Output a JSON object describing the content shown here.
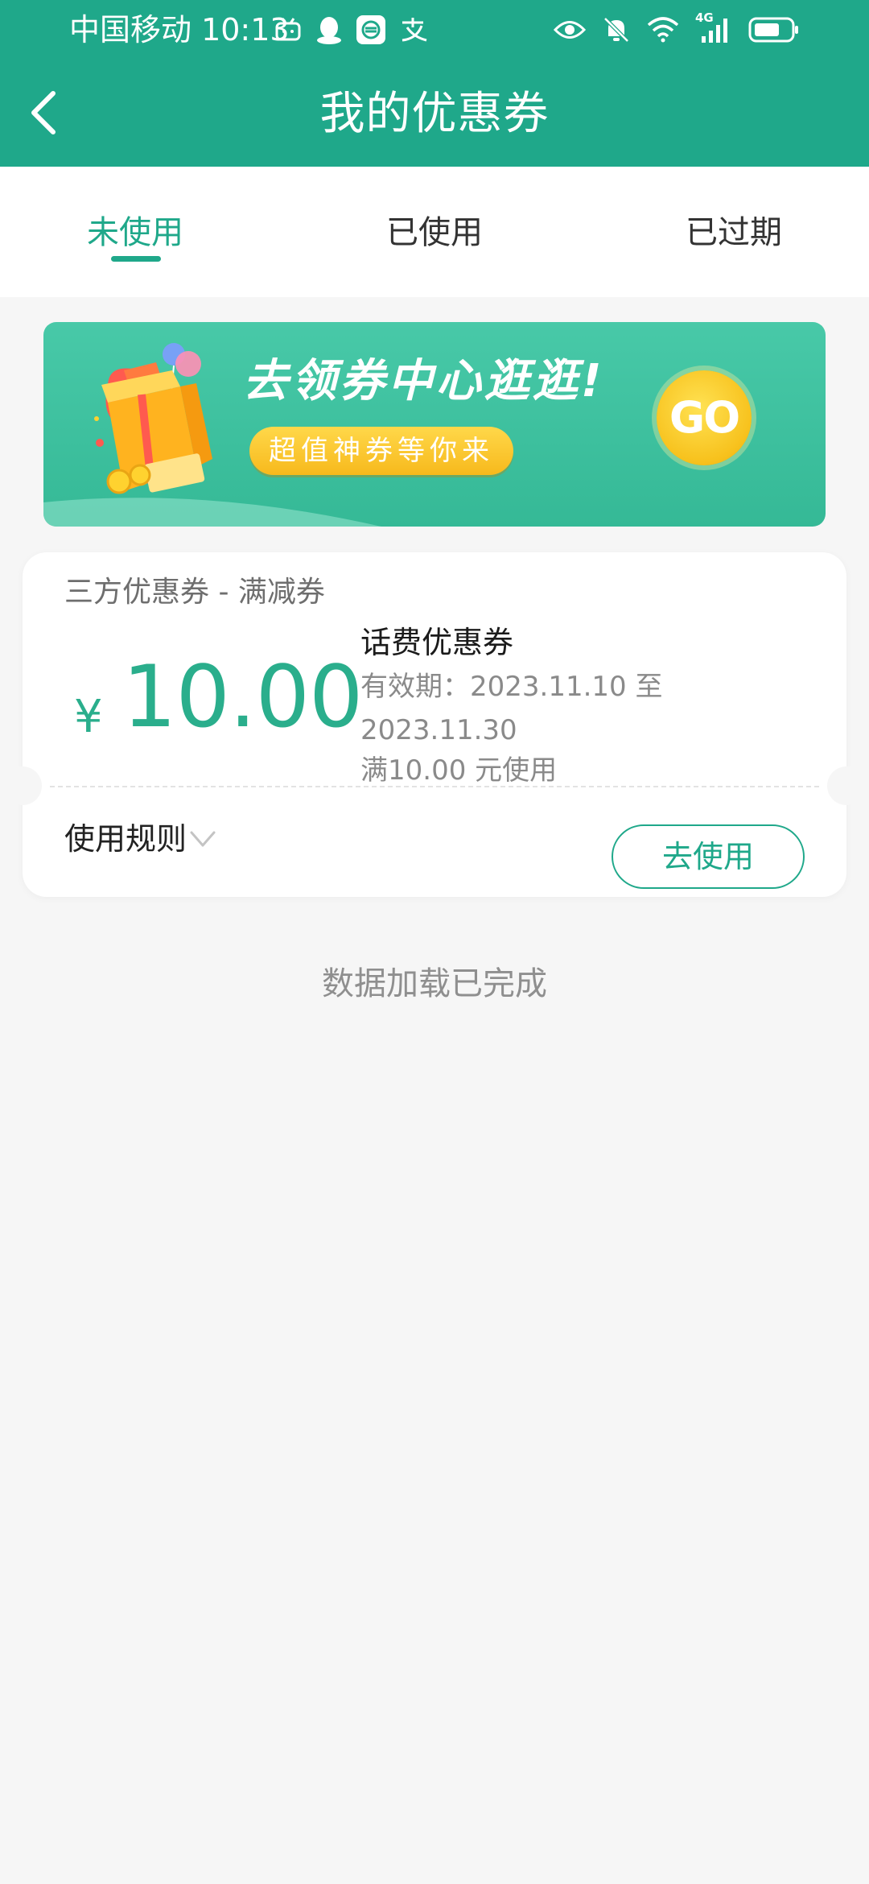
{
  "status_bar": {
    "carrier_time": "中国移动 10:13",
    "network_label": "4G",
    "icons_left": [
      "bilibili-icon",
      "qq-icon",
      "app-icon",
      "alipay-icon"
    ],
    "icons_right": [
      "eye-icon",
      "mute-bell-icon",
      "wifi-icon",
      "signal-icon",
      "battery-icon"
    ]
  },
  "header": {
    "title": "我的优惠券",
    "back_icon": "chevron-left-icon"
  },
  "tabs": [
    {
      "label": "未使用",
      "active": true
    },
    {
      "label": "已使用",
      "active": false
    },
    {
      "label": "已过期",
      "active": false
    }
  ],
  "banner": {
    "title": "去领券中心逛逛!",
    "subtitle": "超值神券等你来",
    "go_label": "GO"
  },
  "coupon": {
    "type_label": "三方优惠券 - 满减券",
    "currency": "¥",
    "amount": "10.00",
    "name": "话费优惠券",
    "validity": "有效期：2023.11.10 至 2023.11.30",
    "condition": "满10.00 元使用",
    "rules_label": "使用规则",
    "use_button": "去使用"
  },
  "footer": {
    "load_status": "数据加载已完成"
  },
  "colors": {
    "primary": "#1fa88a",
    "amount": "#2aae8c",
    "background": "#f6f6f6",
    "banner_yellow": "#f7c11c"
  }
}
